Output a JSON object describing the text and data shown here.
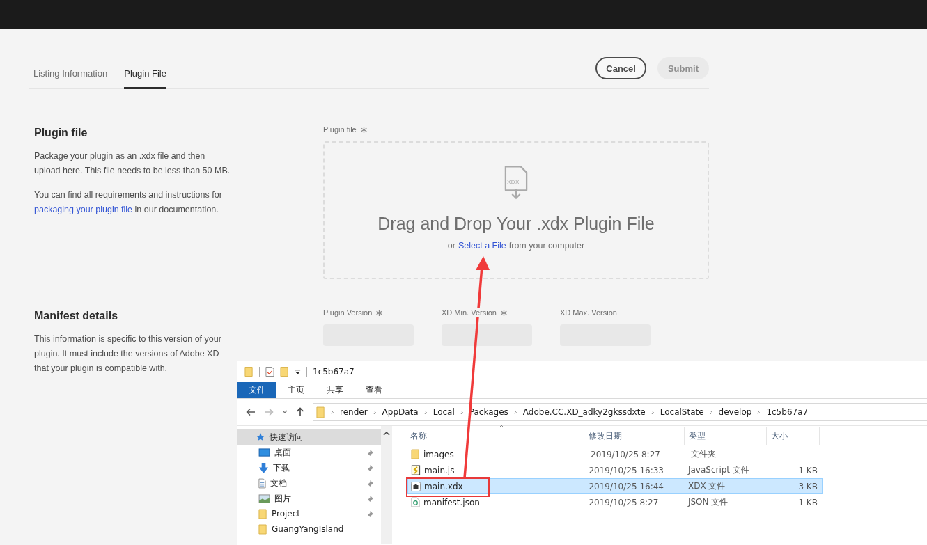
{
  "tabs": [
    {
      "label": "Listing Information",
      "selected": false
    },
    {
      "label": "Plugin File",
      "selected": true
    }
  ],
  "actions": [
    {
      "label": "Cancel",
      "disabled": false
    },
    {
      "label": "Submit",
      "disabled": true
    }
  ],
  "plugin_file": {
    "heading": "Plugin file",
    "paragraphs": [
      "Package your plugin as an .xdx file and then upload here. This file needs to be less than 50 MB."
    ],
    "link_paragraph": {
      "before": "You can find all requirements and instructions for",
      "link": "packaging your plugin file",
      "after": "in our documentation."
    },
    "field_label": "Plugin file",
    "required": true,
    "icon_text": "XDX",
    "drop_title": "Drag and Drop Your .xdx Plugin File",
    "drop_before": "or",
    "drop_link": "Select a File",
    "drop_after": "from your computer"
  },
  "manifest": {
    "heading": "Manifest details",
    "description": "This information is specific to this version of your plugin. It must include the versions of Adobe XD that your plugin is compatible with.",
    "fields": [
      {
        "label": "Plugin Version",
        "required": true
      },
      {
        "label": "XD Min. Version",
        "required": true
      },
      {
        "label": "XD Max. Version"
      }
    ]
  },
  "explorer": {
    "title": "1c5b67a7",
    "ribbon_tabs": [
      {
        "label": "文件",
        "selected": true
      },
      {
        "label": "主页",
        "selected": false
      },
      {
        "label": "共享",
        "selected": false
      },
      {
        "label": "查看",
        "selected": false
      }
    ],
    "path": [
      "render",
      "AppData",
      "Local",
      "Packages",
      "Adobe.CC.XD_adky2gkssdxte",
      "LocalState",
      "develop",
      "1c5b67a7"
    ],
    "sidebar": [
      {
        "label": "快速访问",
        "kind": "star",
        "pinned": false,
        "selected": true
      },
      {
        "label": "桌面",
        "kind": "desktop",
        "pinned": true,
        "selected": false
      },
      {
        "label": "下载",
        "kind": "download",
        "pinned": true,
        "selected": false
      },
      {
        "label": "文档",
        "kind": "document",
        "pinned": true,
        "selected": false
      },
      {
        "label": "图片",
        "kind": "picture",
        "pinned": true,
        "selected": false
      },
      {
        "label": "Project",
        "kind": "folder",
        "pinned": true,
        "selected": false
      },
      {
        "label": "GuangYangIsland",
        "kind": "folder",
        "pinned": false,
        "selected": false
      }
    ],
    "columns": [
      "名称",
      "修改日期",
      "类型",
      "大小"
    ],
    "files": [
      {
        "name": "images",
        "kind": "folder",
        "date": "2019/10/25 8:27",
        "type": "文件夹",
        "selected": false
      },
      {
        "name": "main.js",
        "kind": "script",
        "date": "2019/10/25 16:33",
        "type": "JavaScript 文件",
        "size": "1 KB",
        "selected": false
      },
      {
        "name": "main.xdx",
        "kind": "xdx",
        "date": "2019/10/25 16:44",
        "type": "XDX 文件",
        "size": "3 KB",
        "selected": true
      },
      {
        "name": "manifest.json",
        "kind": "json",
        "date": "2019/10/25 8:27",
        "type": "JSON 文件",
        "size": "1 KB",
        "selected": false
      }
    ]
  }
}
